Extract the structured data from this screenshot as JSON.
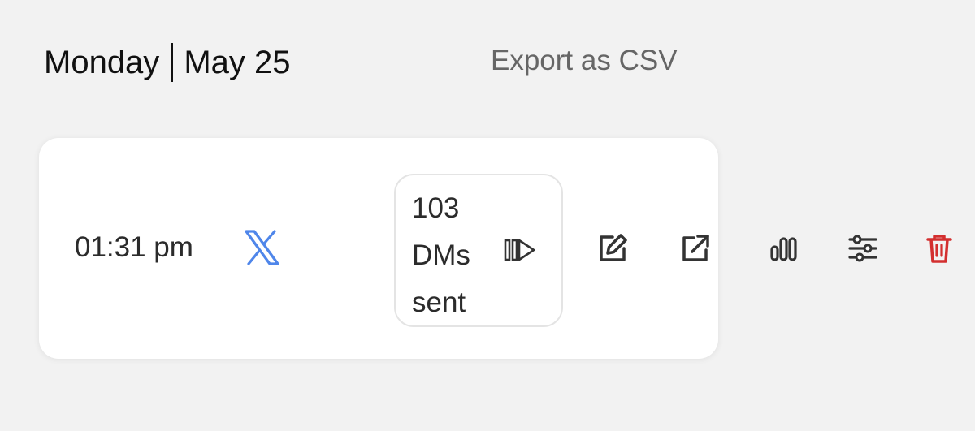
{
  "header": {
    "day": "Monday",
    "date": "May 25",
    "export_label": "Export as CSV"
  },
  "entry": {
    "time": "01:31 pm",
    "platform_icon": "x-logo-icon",
    "dm_count": "103",
    "dm_label_1": "DMs",
    "dm_label_2": "sent",
    "play_icon": "play-icon",
    "actions": {
      "edit_icon": "edit-icon",
      "external_icon": "external-link-icon",
      "stats_icon": "stats-icon",
      "settings_icon": "settings-icon",
      "delete_icon": "delete-icon"
    }
  },
  "colors": {
    "background": "#f2f2f2",
    "card": "#ffffff",
    "accent_blue": "#4f86ea",
    "delete_red": "#d32f2f",
    "muted_text": "#666666"
  }
}
